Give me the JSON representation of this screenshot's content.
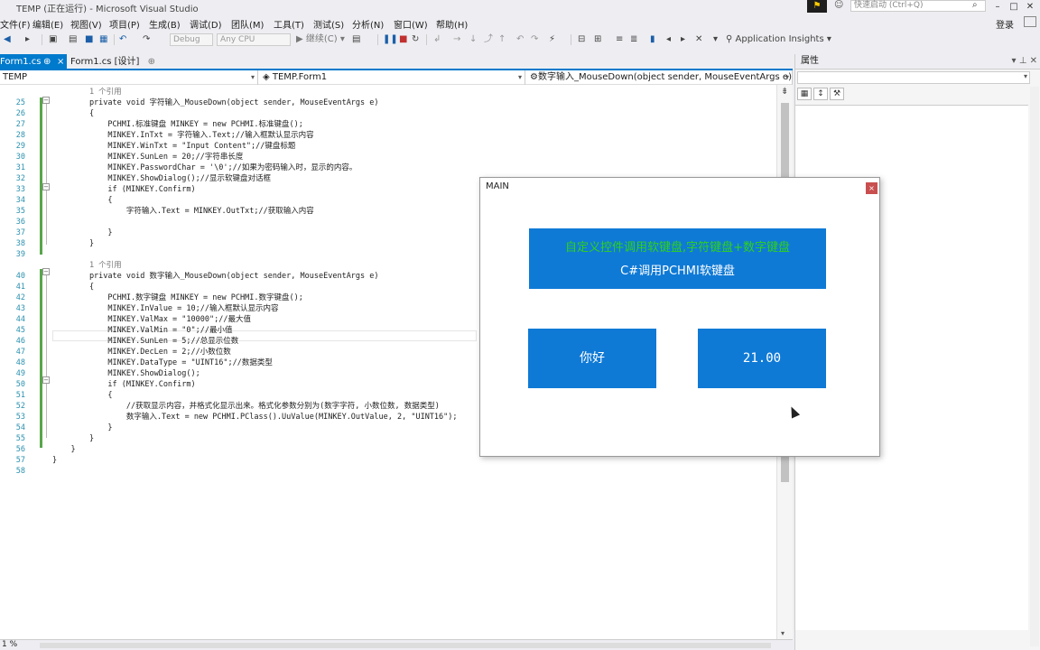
{
  "window": {
    "title": "TEMP (正在运行) - Microsoft Visual Studio",
    "quick_launch_placeholder": "快速启动 (Ctrl+Q)",
    "sign_in": "登录"
  },
  "menu": [
    "文件(F)",
    "编辑(E)",
    "视图(V)",
    "项目(P)",
    "生成(B)",
    "调试(D)",
    "团队(M)",
    "工具(T)",
    "测试(S)",
    "分析(N)",
    "窗口(W)",
    "帮助(H)"
  ],
  "toolbar": {
    "config": "Debug",
    "platform": "Any CPU",
    "continue": "继续(C)",
    "insights": "Application Insights"
  },
  "tabs": [
    {
      "label": "Form1.cs",
      "pin": "⊕",
      "close": "×"
    },
    {
      "label": "Form1.cs [设计]",
      "pin": "⊕"
    }
  ],
  "nav": {
    "project": "TEMP",
    "class": "TEMP.Form1",
    "member": "数字输入_MouseDown(object sender, MouseEventArgs e)"
  },
  "code_lines": [
    {
      "n": "",
      "t": "        1 个引用",
      "ref": true
    },
    {
      "n": "25",
      "t": "        private void 字符输入_MouseDown(object sender, MouseEventArgs e)"
    },
    {
      "n": "26",
      "t": "        {"
    },
    {
      "n": "27",
      "t": "            PCHMI.标准键盘 MINKEY = new PCHMI.标准键盘();"
    },
    {
      "n": "28",
      "t": "            MINKEY.InTxt = 字符输入.Text;//输入框默认显示内容"
    },
    {
      "n": "29",
      "t": "            MINKEY.WinTxt = \"Input Content\";//键盘标题"
    },
    {
      "n": "30",
      "t": "            MINKEY.SunLen = 20;//字符串长度"
    },
    {
      "n": "31",
      "t": "            MINKEY.PasswordChar = '\\0';//如果为密码输入时，显示的内容。"
    },
    {
      "n": "32",
      "t": "            MINKEY.ShowDialog();//显示软键盘对话框"
    },
    {
      "n": "33",
      "t": "            if (MINKEY.Confirm)"
    },
    {
      "n": "34",
      "t": "            {"
    },
    {
      "n": "35",
      "t": "                字符输入.Text = MINKEY.OutTxt;//获取输入内容"
    },
    {
      "n": "36",
      "t": ""
    },
    {
      "n": "37",
      "t": "            }"
    },
    {
      "n": "38",
      "t": "        }"
    },
    {
      "n": "39",
      "t": ""
    },
    {
      "n": "",
      "t": "        1 个引用",
      "ref": true
    },
    {
      "n": "40",
      "t": "        private void 数字输入_MouseDown(object sender, MouseEventArgs e)"
    },
    {
      "n": "41",
      "t": "        {"
    },
    {
      "n": "42",
      "t": "            PCHMI.数字键盘 MINKEY = new PCHMI.数字键盘();"
    },
    {
      "n": "43",
      "t": "            MINKEY.InValue = 10;//输入框默认显示内容"
    },
    {
      "n": "44",
      "t": "            MINKEY.ValMax = \"10000\";//最大值"
    },
    {
      "n": "45",
      "t": "            MINKEY.ValMin = \"0\";//最小值"
    },
    {
      "n": "46",
      "t": "            MINKEY.SunLen = 5;//总显示位数"
    },
    {
      "n": "47",
      "t": "            MINKEY.DecLen = 2;//小数位数"
    },
    {
      "n": "48",
      "t": "            MINKEY.DataType = \"UINT16\";//数据类型"
    },
    {
      "n": "49",
      "t": "            MINKEY.ShowDialog();"
    },
    {
      "n": "50",
      "t": "            if (MINKEY.Confirm)"
    },
    {
      "n": "51",
      "t": "            {"
    },
    {
      "n": "52",
      "t": "                //获取显示内容，并格式化显示出来。格式化参数分别为(数字字符, 小数位数, 数据类型)"
    },
    {
      "n": "53",
      "t": "                数字输入.Text = new PCHMI.PClass().UuValue(MINKEY.OutValue, 2, \"UINT16\");"
    },
    {
      "n": "54",
      "t": "            }"
    },
    {
      "n": "55",
      "t": "        }"
    },
    {
      "n": "56",
      "t": "    }"
    },
    {
      "n": "57",
      "t": "}"
    },
    {
      "n": "58",
      "t": ""
    }
  ],
  "status": {
    "zoom": "1 %"
  },
  "properties": {
    "title": "属性"
  },
  "form": {
    "title": "MAIN",
    "close": "×",
    "banner_line1": "自定义控件调用软键盘,字符键盘+数字键盘",
    "banner_line2": "C#调用PCHMI软键盘",
    "text_button": "你好",
    "number_button": "21.00"
  },
  "colors": {
    "accent": "#007acc",
    "form_button": "#0f7ad6",
    "banner_green": "#2ed21a"
  }
}
